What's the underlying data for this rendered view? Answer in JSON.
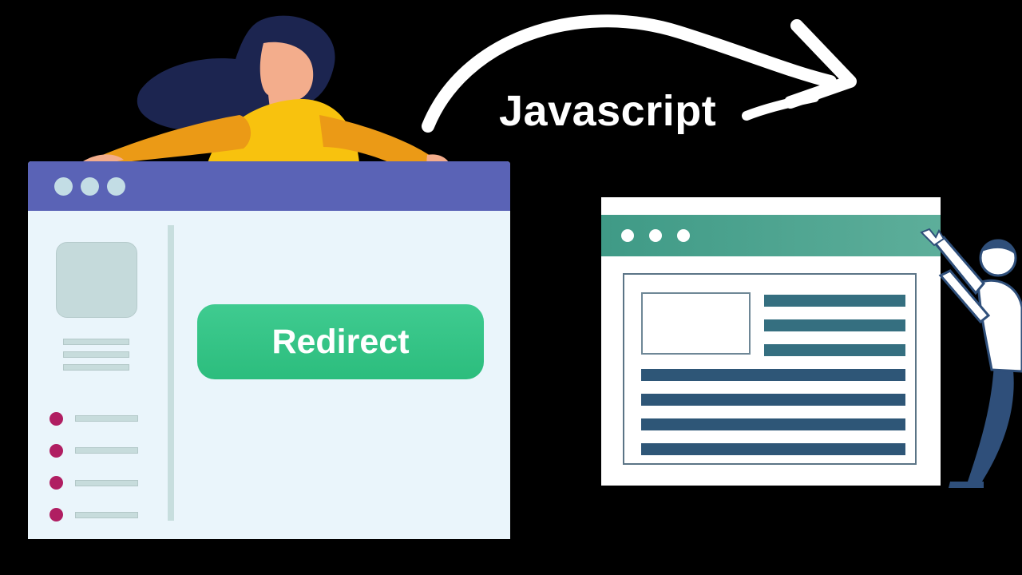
{
  "scene": {
    "background_color": "#000000",
    "arrow_label": "Javascript"
  },
  "left_browser": {
    "titlebar_color": "#5a63b6",
    "button": {
      "label": "Redirect",
      "color": "#34c484"
    },
    "bullet_color": "#b01e62",
    "bullet_count": 4
  },
  "right_browser": {
    "titlebar_color": "#4aa28e",
    "line_color": "#2e5677"
  },
  "icons": [
    "woman-illustration",
    "man-illustration",
    "curved-arrow-icon"
  ]
}
